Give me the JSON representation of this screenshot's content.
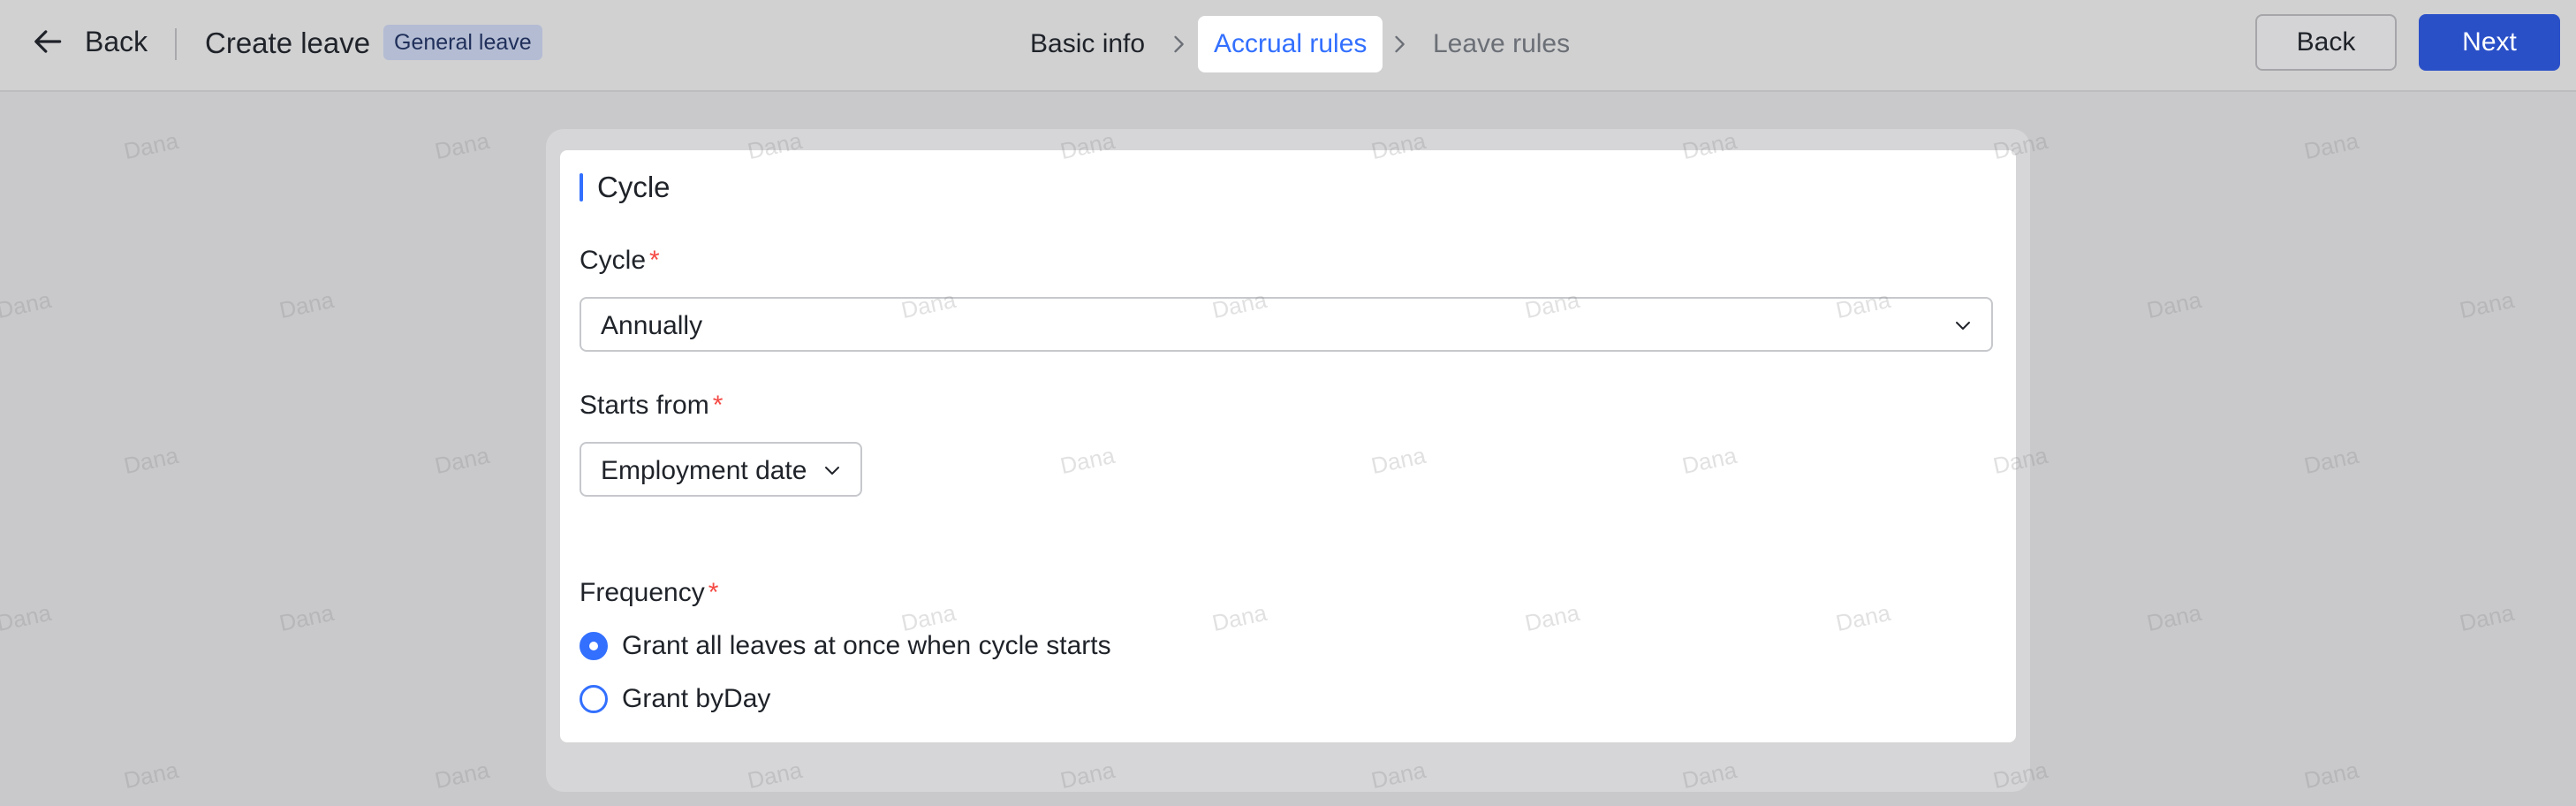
{
  "header": {
    "back_label": "Back",
    "title": "Create leave",
    "tag": "General leave"
  },
  "steps": [
    {
      "label": "Basic info",
      "state": "done"
    },
    {
      "label": "Accrual rules",
      "state": "active"
    },
    {
      "label": "Leave rules",
      "state": "pending"
    }
  ],
  "actions": {
    "back_label": "Back",
    "next_label": "Next"
  },
  "section": {
    "title": "Cycle"
  },
  "form": {
    "cycle": {
      "label": "Cycle",
      "required_mark": "*",
      "value": "Annually"
    },
    "starts_from": {
      "label": "Starts from",
      "required_mark": "*",
      "value": "Employment date"
    },
    "frequency": {
      "label": "Frequency",
      "required_mark": "*",
      "options": [
        {
          "label": "Grant all leaves at once when cycle starts",
          "checked": true
        },
        {
          "label": "Grant byDay",
          "checked": false
        }
      ]
    }
  },
  "watermark": "Dana",
  "colors": {
    "accent": "#3370ff",
    "primary_button": "#2a50c8",
    "required": "#f54a45",
    "overlay": "#c9c9cb"
  }
}
